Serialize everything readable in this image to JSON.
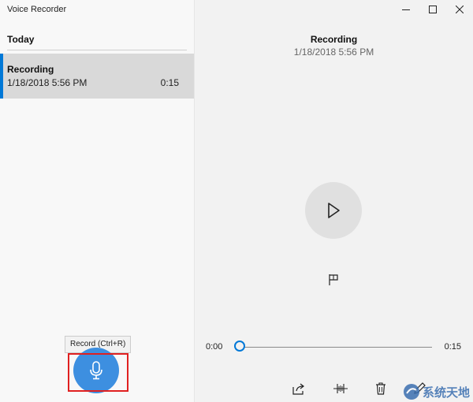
{
  "app": {
    "title": "Voice Recorder"
  },
  "list": {
    "section_label": "Today",
    "items": [
      {
        "title": "Recording",
        "date": "1/18/2018 5:56 PM",
        "duration": "0:15"
      }
    ]
  },
  "record": {
    "tooltip": "Record (Ctrl+R)",
    "icon": "microphone-icon"
  },
  "detail": {
    "title": "Recording",
    "date": "1/18/2018 5:56 PM"
  },
  "playback": {
    "current_time": "0:00",
    "total_time": "0:15",
    "progress": 0
  },
  "toolbar": {
    "icons": [
      "share-icon",
      "trim-icon",
      "delete-icon",
      "rename-icon"
    ]
  },
  "window_controls": {
    "icons": [
      "minimize-icon",
      "maximize-icon",
      "close-icon"
    ]
  },
  "watermark": {
    "text": "系统天地"
  },
  "colors": {
    "accent": "#0078d7",
    "record_button": "#3d8fe0",
    "highlight_box": "#e02020",
    "selected_item": "#d9d9d9"
  }
}
